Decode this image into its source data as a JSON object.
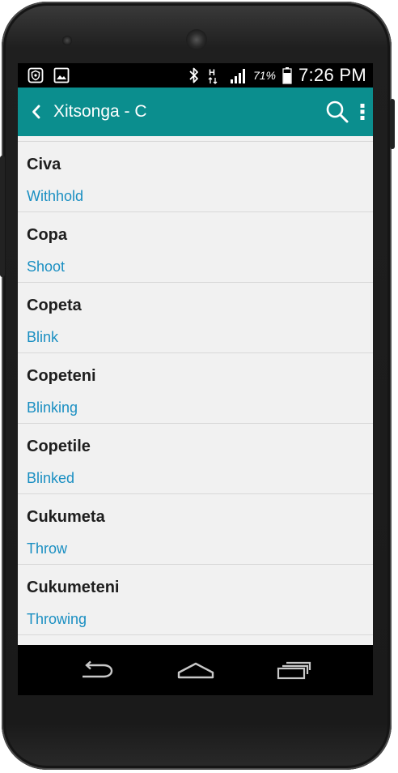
{
  "status_bar": {
    "icons_left": [
      "shield-icon",
      "image-icon"
    ],
    "icons_right": [
      "bluetooth-icon",
      "hplus-data-icon",
      "signal-icon"
    ],
    "network_type": "H",
    "battery_percent": "71%",
    "time": "7:26 PM"
  },
  "app_bar": {
    "title": "Xitsonga - C",
    "background_color": "#0b8e8e",
    "back_icon": "chevron-left-icon",
    "search_icon": "search-icon",
    "overflow_icon": "more-vert-icon"
  },
  "entries": [
    {
      "term": "Civa",
      "definition": "Withhold"
    },
    {
      "term": "Copa",
      "definition": "Shoot"
    },
    {
      "term": "Copeta",
      "definition": "Blink"
    },
    {
      "term": "Copeteni",
      "definition": "Blinking"
    },
    {
      "term": "Copetile",
      "definition": "Blinked"
    },
    {
      "term": "Cukumeta",
      "definition": "Throw"
    },
    {
      "term": "Cukumeteni",
      "definition": "Throwing"
    }
  ],
  "colors": {
    "term": "#1e1e1e",
    "definition": "#1a8fc2",
    "list_background": "#f1f1f1"
  },
  "nav_bar": {
    "back": "back-icon",
    "home": "home-icon",
    "recents": "recent-apps-icon"
  }
}
